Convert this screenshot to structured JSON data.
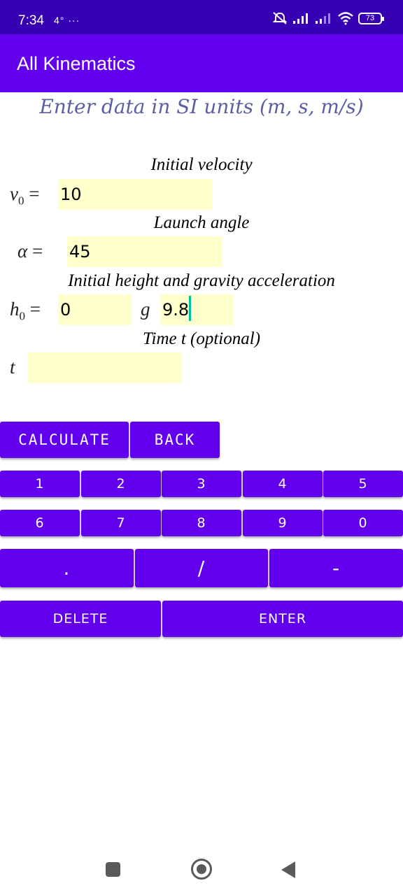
{
  "status_bar": {
    "time": "7:34",
    "extra": "4° ···",
    "battery": "73",
    "icons": [
      "mute-icon",
      "signal-icon",
      "signal-icon",
      "wifi-icon",
      "battery-icon"
    ]
  },
  "app_bar": {
    "title": "All Kinematics"
  },
  "form": {
    "subtitle": "Enter data in SI units (m, s, m/s)",
    "v0": {
      "section": "Initial velocity",
      "symbol": "v",
      "sub": "0",
      "eq": " =",
      "value": "10"
    },
    "alpha": {
      "section": "Launch angle",
      "symbol": "α",
      "eq": " =",
      "value": "45"
    },
    "h0": {
      "section": "Initial height and gravity acceleration",
      "symbol": "h",
      "sub": "0",
      "eq": " =",
      "value": "0"
    },
    "g": {
      "symbol": "g",
      "value": "9.8"
    },
    "t": {
      "section": "Time t (optional)",
      "symbol": "t",
      "value": ""
    }
  },
  "actions": {
    "calculate": "CALCULATE",
    "back": "BACK"
  },
  "keypad": {
    "row1": [
      "1",
      "2",
      "3",
      "4",
      "5"
    ],
    "row2": [
      "6",
      "7",
      "8",
      "9",
      "0"
    ],
    "row3": [
      ".",
      "/",
      "-"
    ],
    "delete": "DELETE",
    "enter": "ENTER"
  },
  "colors": {
    "status": "#3700b3",
    "primary": "#6200ee",
    "input_bg": "#ffffcc",
    "subtitle": "#5b5ea6"
  }
}
